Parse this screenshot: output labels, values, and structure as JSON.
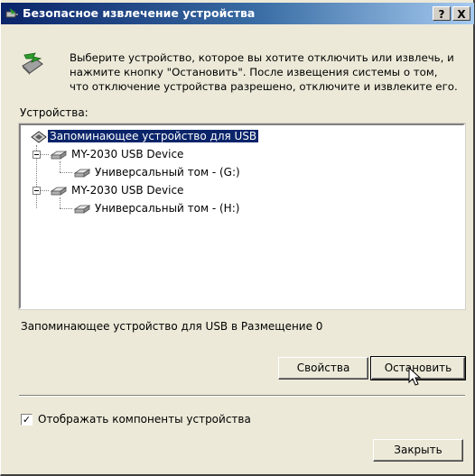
{
  "window": {
    "title": "Безопасное извлечение устройства",
    "help_button": "?",
    "close_button": "X",
    "title_icon": "usb-device-icon"
  },
  "intro": {
    "icon": "usb-remove-icon",
    "text": "Выберите устройство, которое вы хотите отключить или извлечь, и\nнажмите кнопку \"Остановить\". После извещения системы о том,\nчто отключение устройства разрешено, отключите и извлеките его."
  },
  "devices_label": "Устройства:",
  "tree": {
    "items": [
      {
        "label": "Запоминающее устройство для USB",
        "icon": "usb-storage-icon",
        "selected": true
      },
      {
        "label": "MY-2030 USB Device",
        "icon": "disk-drive-icon",
        "expanded": true
      },
      {
        "label": "Универсальный том - (G:)",
        "icon": "volume-icon"
      },
      {
        "label": "MY-2030 USB Device",
        "icon": "disk-drive-icon",
        "expanded": true
      },
      {
        "label": "Универсальный том - (H:)",
        "icon": "volume-icon"
      }
    ]
  },
  "location_text": "Запоминающее устройство для USB в Размещение 0",
  "buttons": {
    "properties": "Свойства",
    "stop": "Остановить",
    "close": "Закрыть"
  },
  "show_components": {
    "label": "Отображать компоненты устройства",
    "checked": true,
    "mark": "✓"
  }
}
